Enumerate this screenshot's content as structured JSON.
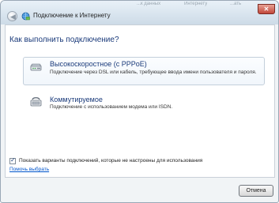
{
  "window": {
    "title": "Подключение к Интернету",
    "background_text": [
      "...к данных",
      "Интернету",
      "...ать"
    ]
  },
  "main": {
    "heading": "Как выполнить подключение?",
    "options": [
      {
        "title": "Высокоскоростное (с PPPoE)",
        "description": "Подключение через DSL или кабель, требующее ввода имени пользователя и пароля.",
        "icon": "broadband-modem-icon"
      },
      {
        "title": "Коммутируемое",
        "description": "Подключение с использованием модема или ISDN.",
        "icon": "dialup-modem-icon"
      }
    ],
    "show_unconfigured": {
      "label": "Показать варианты подключений, которые не настроены для использования",
      "checked": true
    },
    "help_link": "Помочь выбрать"
  },
  "footer": {
    "cancel_label": "Отмена"
  },
  "colors": {
    "accent_text": "#1a3a7a",
    "link": "#0055cc",
    "close": "#c1473a"
  }
}
